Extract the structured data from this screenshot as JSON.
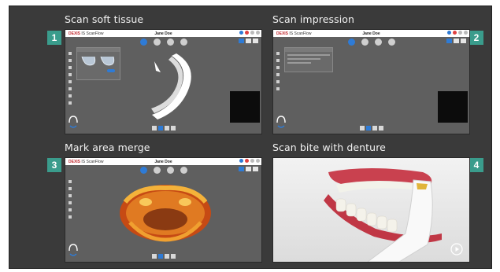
{
  "panels": [
    {
      "number": "1",
      "caption": "Scan soft tissue",
      "app_logo": "DEXIS",
      "app_name": "IS ScanFlow",
      "patient": "Jane Doe"
    },
    {
      "number": "2",
      "caption": "Scan impression",
      "app_logo": "DEXIS",
      "app_name": "IS ScanFlow",
      "patient": "Jane Doe"
    },
    {
      "number": "3",
      "caption": "Mark area merge",
      "app_logo": "DEXIS",
      "app_name": "IS ScanFlow",
      "patient": "Jane Doe"
    },
    {
      "number": "4",
      "caption": "Scan bite with denture"
    }
  ],
  "colors": {
    "badge": "#3a9c8c",
    "frame_bg": "#3a3a3a",
    "screen_bg": "#5f5f5f",
    "accent_blue": "#2e7bd6",
    "logo_red": "#c0282e"
  },
  "icons": [
    "play-icon",
    "headset-icon"
  ]
}
